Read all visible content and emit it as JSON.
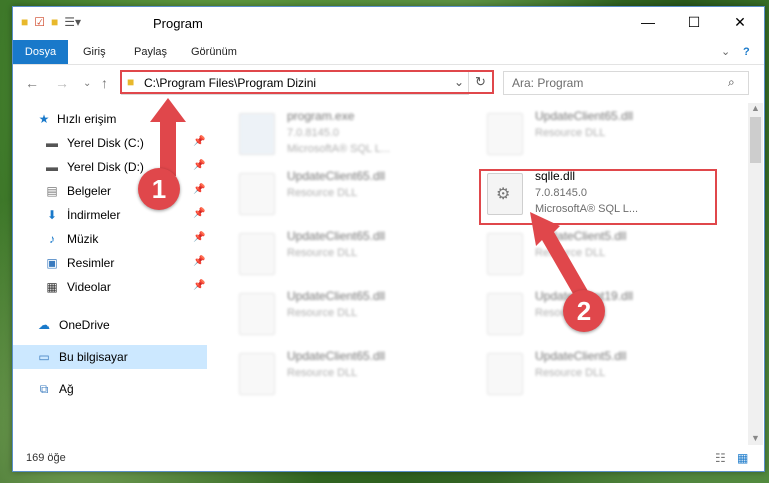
{
  "window": {
    "title": "Program",
    "controls": [
      "—",
      "☐",
      "✕"
    ]
  },
  "ribbon": {
    "tabs": [
      "Dosya",
      "Giriş",
      "Paylaş",
      "Görünüm"
    ]
  },
  "address": {
    "path": "C:\\Program Files\\Program Dizini"
  },
  "search": {
    "placeholder": "Ara: Program"
  },
  "sidebar": {
    "items": [
      {
        "label": "Hızlı erişim",
        "icon": "star-icon"
      },
      {
        "label": "Yerel Disk (C:)",
        "icon": "drive-icon",
        "pinned": true
      },
      {
        "label": "Yerel Disk (D:)",
        "icon": "drive-icon",
        "pinned": true
      },
      {
        "label": "Belgeler",
        "icon": "documents-icon",
        "pinned": true
      },
      {
        "label": "İndirmeler",
        "icon": "download-icon",
        "pinned": true
      },
      {
        "label": "Müzik",
        "icon": "music-icon",
        "pinned": true
      },
      {
        "label": "Resimler",
        "icon": "pictures-icon",
        "pinned": true
      },
      {
        "label": "Videolar",
        "icon": "videos-icon",
        "pinned": true
      },
      {
        "label": "OneDrive",
        "icon": "cloud-icon"
      },
      {
        "label": "Bu bilgisayar",
        "icon": "computer-icon",
        "selected": true
      },
      {
        "label": "Ağ",
        "icon": "network-icon"
      }
    ]
  },
  "files": [
    {
      "name": "program.exe",
      "line2": "7.0.8145.0",
      "line3": "MicrosoftA® SQL L..."
    },
    {
      "name": "UpdateClient65.dll",
      "line2": "Resource DLL"
    },
    {
      "name": "UpdateClient65.dll",
      "line2": "Resource DLL"
    },
    {
      "name": "sqlle.dll",
      "line2": "7.0.8145.0",
      "line3": "MicrosoftA® SQL L..."
    },
    {
      "name": "UpdateClient65.dll",
      "line2": "Resource DLL"
    },
    {
      "name": "UpdateClient5.dll",
      "line2": "Resource DLL"
    },
    {
      "name": "UpdateClient65.dll",
      "line2": "Resource DLL"
    },
    {
      "name": "UpdateClient19.dll",
      "line2": "Resource DLL"
    },
    {
      "name": "UpdateClient65.dll",
      "line2": "Resource DLL"
    },
    {
      "name": "UpdateClient5.dll",
      "line2": "Resource DLL"
    }
  ],
  "status": {
    "count": "169 öğe"
  },
  "annotations": {
    "step1": "1",
    "step2": "2"
  },
  "colors": {
    "accent": "#1979ca",
    "highlight": "#e0474b"
  }
}
